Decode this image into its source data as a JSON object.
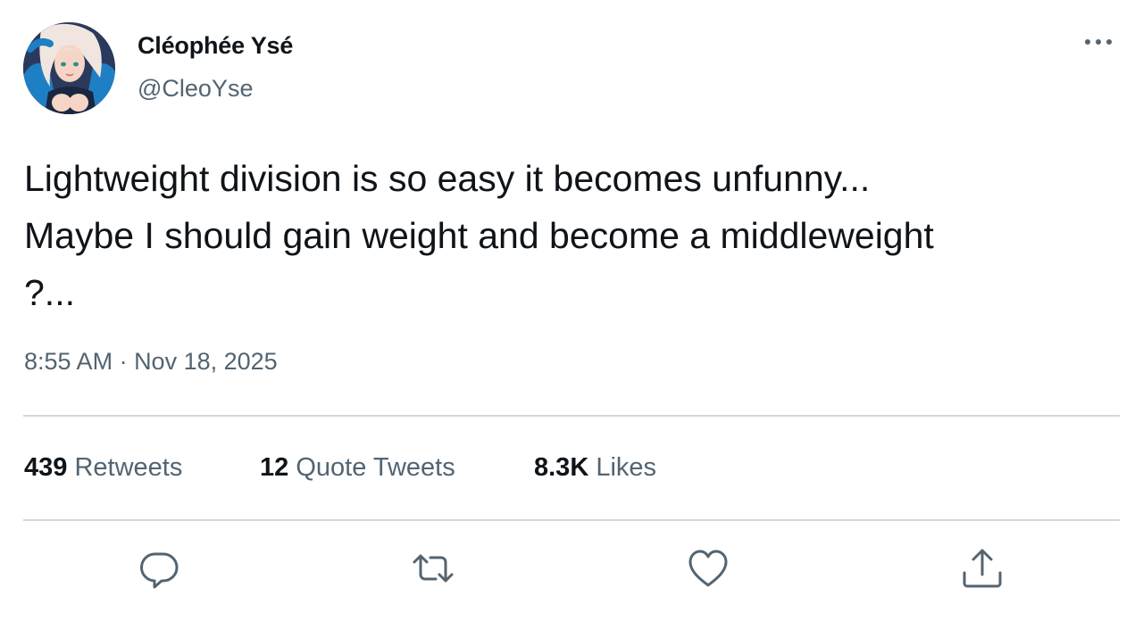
{
  "author": {
    "display_name": "Cléophée Ysé",
    "handle": "@CleoYse",
    "avatar_icon": "user-avatar-illustration"
  },
  "tweet": {
    "lines": [
      "Lightweight division is so easy it becomes unfunny...",
      "Maybe I should gain weight and become a middleweight",
      "?..."
    ],
    "time": "8:55 AM",
    "separator": " · ",
    "date": "Nov 18, 2025"
  },
  "stats": {
    "retweets": {
      "count": "439",
      "label": "Retweets"
    },
    "quotes": {
      "count": "12",
      "label": "Quote Tweets"
    },
    "likes": {
      "count": "8.3K",
      "label": "Likes"
    }
  },
  "actions": [
    "reply-icon",
    "retweet-icon",
    "like-icon",
    "share-icon"
  ],
  "colors": {
    "text_primary": "#0f1419",
    "text_secondary": "#536471",
    "divider": "#cfd9de",
    "background": "#ffffff"
  }
}
